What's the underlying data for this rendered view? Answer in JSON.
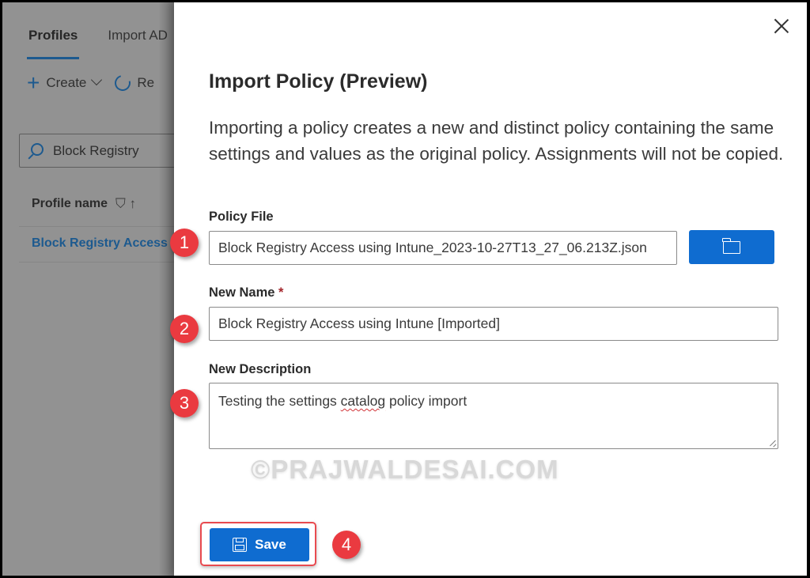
{
  "background_page": {
    "tabs": [
      {
        "label": "Profiles",
        "active": true
      },
      {
        "label": "Import AD",
        "active": false
      }
    ],
    "toolbar": {
      "create_label": "Create",
      "refresh_label": "Re"
    },
    "search": {
      "value": "Block Registry"
    },
    "table": {
      "column_header": "Profile name",
      "rows": [
        "Block Registry Access"
      ]
    }
  },
  "dialog": {
    "title": "Import Policy (Preview)",
    "description": "Importing a policy creates a new and distinct policy containing the same settings and values as the original policy. Assignments will not be copied.",
    "close_icon": "close-icon",
    "fields": {
      "policy_file": {
        "label": "Policy File",
        "value": "Block Registry Access using Intune_2023-10-27T13_27_06.213Z.json",
        "browse_icon": "folder-icon"
      },
      "new_name": {
        "label": "New Name",
        "required_marker": "*",
        "value": "Block Registry Access using Intune [Imported]"
      },
      "new_description": {
        "label": "New Description",
        "value_before": "Testing the settings ",
        "value_misspelled": "catalog",
        "value_after": " policy import"
      }
    },
    "save_button": {
      "label": "Save",
      "icon": "save-icon"
    }
  },
  "annotations": {
    "badges": [
      "1",
      "2",
      "3",
      "4"
    ],
    "color": "#ea3a40"
  },
  "watermark": "©PRAJWALDESAI.COM",
  "colors": {
    "accent": "#0f6cd0",
    "link": "#1d5a8f",
    "required": "#a4262c"
  }
}
